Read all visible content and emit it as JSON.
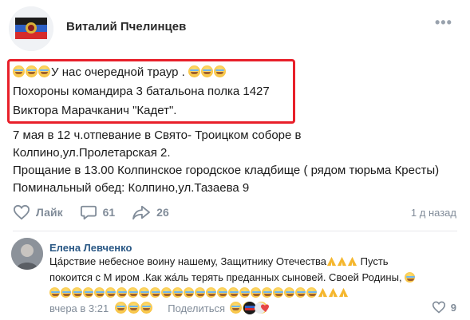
{
  "post": {
    "author": "Виталий Пчелинцев",
    "highlight": {
      "line1": "У нас очередной траур .",
      "line2": "Похороны командира 3 батальона полка 1427",
      "line3": "Виктора Марачканич \"Кадет\"."
    },
    "body": {
      "line1": "7 мая в 12 ч.отпевание в Свято- Троицком соборе в",
      "line2": "Колпино,ул.Пролетарская 2.",
      "line3": "Прощание в 13.00 Колпинское городское кладбище ( рядом тюрьма Кресты)",
      "line4": "Поминальный обед: Колпино,ул.Тазаева 9"
    },
    "actions": {
      "like_label": "Лайк",
      "comments_count": "61",
      "shares_count": "26"
    },
    "time": "1 д назад"
  },
  "comment": {
    "author": "Елена Левченко",
    "line1": "Ца́рствие небесное воину нашему, Защитнику Отечества",
    "line1_tail": " Пусть",
    "line2": "покоится с М иром .Как жа́ль терять преданных сыновей. Своей Родины,",
    "time": "вчера в 3:21",
    "share_label": "Поделиться",
    "likes_count": "9"
  },
  "colors": {
    "highlight_border": "#e8202a",
    "link": "#2a5885",
    "muted": "#818c99"
  },
  "icons": [
    "flag-avatar",
    "more-icon",
    "heart-icon",
    "comment-icon",
    "share-icon",
    "crying-emoji",
    "praying-hands-emoji",
    "reactions-icon"
  ]
}
